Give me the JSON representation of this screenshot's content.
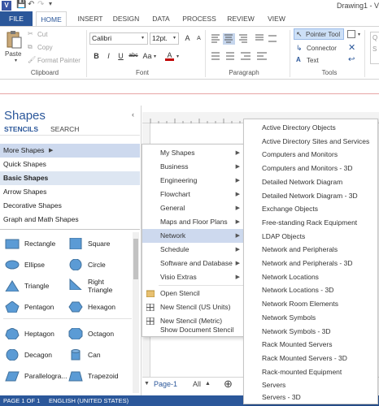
{
  "window": {
    "app_icon": "visio-app-icon",
    "app_icon_text": "V",
    "title": "Drawing1 - Vi",
    "quick_access": [
      "save-icon",
      "undo-icon",
      "redo-icon",
      "customize-icon"
    ]
  },
  "tabs": [
    "FILE",
    "HOME",
    "INSERT",
    "DESIGN",
    "DATA",
    "PROCESS",
    "REVIEW",
    "VIEW"
  ],
  "ribbon": {
    "clipboard": {
      "paste": "Paste",
      "cut": "Cut",
      "copy": "Copy",
      "format_painter": "Format Painter",
      "label": "Clipboard"
    },
    "font": {
      "font_name": "Calibri",
      "font_size": "12pt.",
      "grow": "A",
      "shrink": "A",
      "bold": "B",
      "italic": "I",
      "underline": "U",
      "strike": "abc",
      "case": "Aa",
      "color": "A",
      "label": "Font"
    },
    "paragraph": {
      "label": "Paragraph"
    },
    "tools": {
      "pointer": "Pointer Tool",
      "connector": "Connector",
      "text": "Text",
      "label": "Tools"
    },
    "styles_cut": "Q\nS"
  },
  "shapes_pane": {
    "title": "Shapes",
    "tabs": [
      "STENCILS",
      "SEARCH"
    ],
    "stencils": [
      "More Shapes",
      "Quick Shapes",
      "Basic Shapes",
      "Arrow Shapes",
      "Decorative Shapes",
      "Graph and Math Shapes"
    ],
    "shapes": [
      [
        "Rectangle",
        "Square"
      ],
      [
        "Ellipse",
        "Circle"
      ],
      [
        "Triangle",
        "Right Triangle"
      ],
      [
        "Pentagon",
        "Hexagon"
      ],
      [
        "Heptagon",
        "Octagon"
      ],
      [
        "Decagon",
        "Can"
      ],
      [
        "Parallelogra...",
        "Trapezoid"
      ]
    ]
  },
  "more_shapes_menu": {
    "items": [
      "My Shapes",
      "Business",
      "Engineering",
      "Flowchart",
      "General",
      "Maps and Floor Plans",
      "Network",
      "Schedule",
      "Software and Database",
      "Visio Extras"
    ],
    "actions": [
      "Open Stencil",
      "New Stencil (US Units)",
      "New Stencil (Metric)",
      "Show Document Stencil"
    ]
  },
  "network_submenu": {
    "items": [
      "Active Directory Objects",
      "Active Directory Sites and Services",
      "Computers and Monitors",
      "Computers and Monitors - 3D",
      "Detailed Network Diagram",
      "Detailed Network Diagram - 3D",
      "Exchange Objects",
      "Free-standing Rack Equipment",
      "LDAP Objects",
      "Network and Peripherals",
      "Network and Peripherals - 3D",
      "Network Locations",
      "Network Locations - 3D",
      "Network Room Elements",
      "Network Symbols",
      "Network Symbols - 3D",
      "Rack Mounted Servers",
      "Rack Mounted Servers - 3D",
      "Rack-mounted Equipment",
      "Servers",
      "Servers - 3D"
    ]
  },
  "page_tabs": {
    "page": "Page-1",
    "all": "All"
  },
  "status": {
    "page_info": "PAGE 1 OF 1",
    "language": "ENGLISH (UNITED STATES)"
  },
  "colors": {
    "accent": "#2b579a",
    "shape_fill": "#5b9bd5",
    "hover": "#cdd9ee"
  }
}
